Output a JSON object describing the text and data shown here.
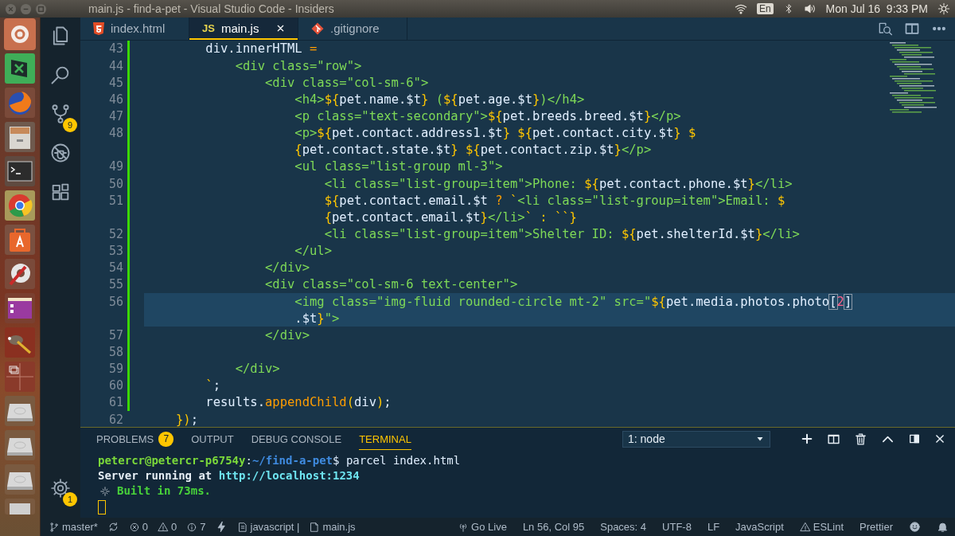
{
  "window": {
    "title": "main.js - find-a-pet - Visual Studio Code - Insiders"
  },
  "system_tray": {
    "keyboard": "En",
    "clock": "Mon Jul 16  9:33 PM"
  },
  "activity_bar": {
    "source_control_badge": "9",
    "manage_badge": "1"
  },
  "tabs": [
    {
      "kind": "html",
      "label": "index.html",
      "selected": false
    },
    {
      "kind": "js",
      "icon_text": "JS",
      "label": "main.js",
      "selected": true
    },
    {
      "kind": "git",
      "label": ".gitignore",
      "selected": false
    }
  ],
  "editor": {
    "lines": [
      {
        "number": "43",
        "current": false,
        "tokens": [
          {
            "kind": "plain",
            "text": "    div.innerHTML "
          },
          {
            "kind": "op",
            "text": "="
          }
        ]
      },
      {
        "number": "44",
        "current": false,
        "tokens": [
          {
            "kind": "tag",
            "text": "        <div class=\"row\">"
          }
        ]
      },
      {
        "number": "45",
        "current": false,
        "tokens": [
          {
            "kind": "tag",
            "text": "            <div class=\"col-sm-6\">"
          }
        ]
      },
      {
        "number": "46",
        "current": false,
        "tokens": [
          {
            "kind": "tag",
            "text": "                <h4>"
          },
          {
            "kind": "brace",
            "text": "${"
          },
          {
            "kind": "plain",
            "text": "pet.name.$t"
          },
          {
            "kind": "brace",
            "text": "}"
          },
          {
            "kind": "tag",
            "text": " ("
          },
          {
            "kind": "brace",
            "text": "${"
          },
          {
            "kind": "plain",
            "text": "pet.age.$t"
          },
          {
            "kind": "brace",
            "text": "}"
          },
          {
            "kind": "tag",
            "text": ")</h4>"
          }
        ]
      },
      {
        "number": "47",
        "current": false,
        "tokens": [
          {
            "kind": "tag",
            "text": "                <p class=\"text-secondary\">"
          },
          {
            "kind": "brace",
            "text": "${"
          },
          {
            "kind": "plain",
            "text": "pet.breeds.breed.$t"
          },
          {
            "kind": "brace",
            "text": "}"
          },
          {
            "kind": "tag",
            "text": "</p>"
          }
        ]
      },
      {
        "number": "48",
        "current": false,
        "tokens": [
          {
            "kind": "tag",
            "text": "                <p>"
          },
          {
            "kind": "brace",
            "text": "${"
          },
          {
            "kind": "plain",
            "text": "pet.contact.address1.$t"
          },
          {
            "kind": "brace",
            "text": "}"
          },
          {
            "kind": "brace",
            "text": " ${"
          },
          {
            "kind": "plain",
            "text": "pet.contact.city.$t"
          },
          {
            "kind": "brace",
            "text": "}"
          },
          {
            "kind": "brace",
            "text": " $"
          }
        ]
      },
      {
        "current": false,
        "tokens": [
          {
            "kind": "brace",
            "text": "                {"
          },
          {
            "kind": "plain",
            "text": "pet.contact.state.$t"
          },
          {
            "kind": "brace",
            "text": "}"
          },
          {
            "kind": "brace",
            "text": " ${"
          },
          {
            "kind": "plain",
            "text": "pet.contact.zip.$t"
          },
          {
            "kind": "brace",
            "text": "}"
          },
          {
            "kind": "tag",
            "text": "</p>"
          }
        ]
      },
      {
        "number": "49",
        "current": false,
        "tokens": [
          {
            "kind": "tag",
            "text": "                <ul class=\"list-group ml-3\">"
          }
        ]
      },
      {
        "number": "50",
        "current": false,
        "tokens": [
          {
            "kind": "tag",
            "text": "                    <li class=\"list-group=item\">Phone: "
          },
          {
            "kind": "brace",
            "text": "${"
          },
          {
            "kind": "plain",
            "text": "pet.contact.phone.$t"
          },
          {
            "kind": "brace",
            "text": "}"
          },
          {
            "kind": "tag",
            "text": "</li>"
          }
        ]
      },
      {
        "number": "51",
        "current": false,
        "tokens": [
          {
            "kind": "brace",
            "text": "                    ${"
          },
          {
            "kind": "plain",
            "text": "pet.contact.email.$t "
          },
          {
            "kind": "op",
            "text": "?"
          },
          {
            "kind": "brace",
            "text": " `"
          },
          {
            "kind": "tag",
            "text": "<li class=\"list-group=item\">Email: "
          },
          {
            "kind": "brace",
            "text": "$"
          }
        ]
      },
      {
        "current": false,
        "tokens": [
          {
            "kind": "brace",
            "text": "                    {"
          },
          {
            "kind": "plain",
            "text": "pet.contact.email.$t"
          },
          {
            "kind": "brace",
            "text": "}"
          },
          {
            "kind": "tag",
            "text": "</li>"
          },
          {
            "kind": "brace",
            "text": "` : ``}"
          }
        ]
      },
      {
        "number": "52",
        "current": false,
        "tokens": [
          {
            "kind": "tag",
            "text": "                    <li class=\"list-group=item\">Shelter ID: "
          },
          {
            "kind": "brace",
            "text": "${"
          },
          {
            "kind": "plain",
            "text": "pet.shelterId.$t"
          },
          {
            "kind": "brace",
            "text": "}"
          },
          {
            "kind": "tag",
            "text": "</li>"
          }
        ]
      },
      {
        "number": "53",
        "current": false,
        "tokens": [
          {
            "kind": "tag",
            "text": "                </ul>"
          }
        ]
      },
      {
        "number": "54",
        "current": false,
        "tokens": [
          {
            "kind": "tag",
            "text": "            </div>"
          }
        ]
      },
      {
        "number": "55",
        "current": false,
        "tokens": [
          {
            "kind": "tag",
            "text": "            <div class=\"col-sm-6 text-center\">"
          }
        ]
      },
      {
        "number": "56",
        "current": true,
        "tokens": [
          {
            "kind": "tag",
            "text": "                <img class=\"img-fluid rounded-circle mt-2\" src=\""
          },
          {
            "kind": "brace",
            "text": "${"
          },
          {
            "kind": "plain",
            "text": "pet.media.photos.photo"
          },
          {
            "kind": "bracket",
            "text": "["
          },
          {
            "kind": "num",
            "text": "2"
          },
          {
            "kind": "bracket",
            "text": "]"
          }
        ]
      },
      {
        "current": true,
        "tokens": [
          {
            "kind": "plain",
            "text": "                .$t"
          },
          {
            "kind": "brace",
            "text": "}"
          },
          {
            "kind": "tag",
            "text": "\">"
          }
        ]
      },
      {
        "number": "57",
        "current": false,
        "tokens": [
          {
            "kind": "tag",
            "text": "            </div>"
          }
        ]
      },
      {
        "number": "58",
        "current": false
      },
      {
        "number": "59",
        "current": false,
        "tokens": [
          {
            "kind": "tag",
            "text": "        </div>"
          }
        ]
      },
      {
        "number": "60",
        "current": false,
        "tokens": [
          {
            "kind": "brace",
            "text": "    `"
          },
          {
            "kind": "plain",
            "text": ";"
          }
        ]
      },
      {
        "number": "61",
        "current": false,
        "tokens": [
          {
            "kind": "plain",
            "text": "    results."
          },
          {
            "kind": "fn",
            "text": "appendChild"
          },
          {
            "kind": "brace",
            "text": "("
          },
          {
            "kind": "plain",
            "text": "div"
          },
          {
            "kind": "brace",
            "text": ")"
          },
          {
            "kind": "plain",
            "text": ";"
          }
        ]
      },
      {
        "number": "62",
        "current": false,
        "tokens": [
          {
            "kind": "brace",
            "text": "})"
          },
          {
            "kind": "plain",
            "text": ";"
          }
        ]
      }
    ]
  },
  "panel": {
    "tabs": [
      {
        "label": "PROBLEMS",
        "badge": "7",
        "selected": false
      },
      {
        "label": "OUTPUT",
        "selected": false
      },
      {
        "label": "DEBUG CONSOLE",
        "selected": false
      },
      {
        "label": "TERMINAL",
        "selected": true
      }
    ],
    "terminal_select": "1: node",
    "terminal": [
      {
        "kind": "text",
        "tokens": [
          {
            "kind": "user",
            "text": "petercr@petercr-p6754y"
          },
          {
            "kind": "plain",
            "text": ":"
          },
          {
            "kind": "path",
            "text": "~/find-a-pet"
          },
          {
            "kind": "plain",
            "text": "$ parcel index.html"
          }
        ]
      },
      {
        "kind": "text",
        "tokens": [
          {
            "kind": "bold",
            "text": "Server running at "
          },
          {
            "kind": "link",
            "text": "http://localhost:1234"
          }
        ]
      },
      {
        "kind": "sparkle",
        "tokens": [
          {
            "kind": "success",
            "text": "Built in 73ms."
          }
        ]
      },
      {
        "kind": "cursor"
      }
    ]
  },
  "status_bar": {
    "left": [
      {
        "kind": "branch",
        "text": "master*"
      },
      {
        "kind": "sync"
      },
      {
        "kind": "errors",
        "text": "0"
      },
      {
        "kind": "warnings",
        "text": "0"
      },
      {
        "kind": "infos",
        "text": "7"
      },
      {
        "kind": "bolt"
      },
      {
        "kind": "language",
        "text": "javascript |"
      },
      {
        "kind": "file",
        "text": "main.js"
      }
    ],
    "right": [
      {
        "kind": "live",
        "text": "Go Live"
      },
      {
        "kind": "plain",
        "text": "Ln 56, Col 95"
      },
      {
        "kind": "plain",
        "text": "Spaces: 4"
      },
      {
        "kind": "plain",
        "text": "UTF-8"
      },
      {
        "kind": "plain",
        "text": "LF"
      },
      {
        "kind": "plain",
        "text": "JavaScript"
      },
      {
        "kind": "lint",
        "text": "ESLint"
      },
      {
        "kind": "plain",
        "text": "Prettier"
      },
      {
        "kind": "feedback"
      },
      {
        "kind": "notifications"
      }
    ]
  }
}
